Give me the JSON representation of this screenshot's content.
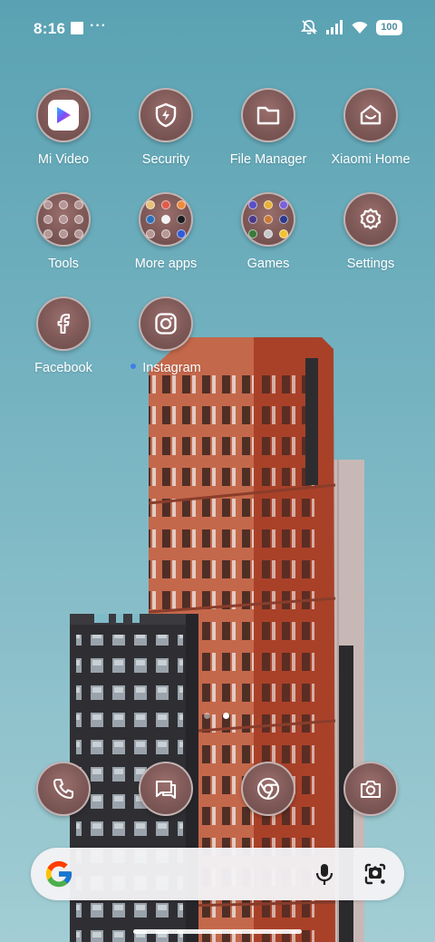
{
  "status_bar": {
    "time": "8:16",
    "more_indicator": "···",
    "battery": "100",
    "icons": [
      "muted-bell-icon",
      "signal-icon",
      "wifi-icon",
      "battery-icon"
    ]
  },
  "apps": [
    {
      "label": "Mi Video",
      "icon": "mi-video-icon"
    },
    {
      "label": "Security",
      "icon": "security-shield-icon"
    },
    {
      "label": "File Manager",
      "icon": "folder-icon"
    },
    {
      "label": "Xiaomi Home",
      "icon": "xiaomi-home-icon"
    },
    {
      "label": "Tools",
      "icon": "folder-tools-icon"
    },
    {
      "label": "More apps",
      "icon": "folder-more-apps-icon"
    },
    {
      "label": "Games",
      "icon": "folder-games-icon"
    },
    {
      "label": "Settings",
      "icon": "gear-icon"
    },
    {
      "label": "Facebook",
      "icon": "facebook-icon"
    },
    {
      "label": "Instagram",
      "icon": "instagram-icon",
      "new_install_dot": true
    }
  ],
  "page_indicator": {
    "pages": 2,
    "current": 2
  },
  "dock": [
    {
      "icon": "phone-icon"
    },
    {
      "icon": "messages-icon"
    },
    {
      "icon": "chrome-icon"
    },
    {
      "icon": "camera-icon"
    }
  ],
  "search_bar": {
    "google_icon": "google-g-icon",
    "mic_icon": "mic-icon",
    "lens_icon": "google-lens-icon"
  },
  "colors": {
    "sky": "#6aabbb",
    "icon_fill": "#7d5856",
    "building_orange": "#b8533a",
    "building_dark": "#2f2f33",
    "notify_dot": "#3d7fe8"
  }
}
